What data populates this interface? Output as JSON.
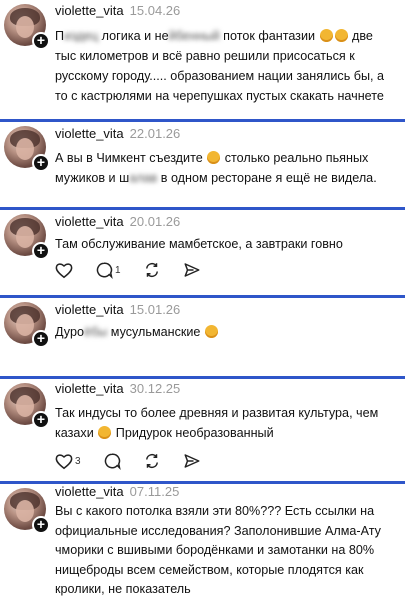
{
  "posts": [
    {
      "username": "violette_vita",
      "date": "15.04.26",
      "text_1": "П",
      "text_blur_1": "издец",
      "text_2": " логика и не",
      "text_blur_2": "йбенный",
      "text_3": " поток фантазии ",
      "text_4": " две тыс километров и всё равно решили присосаться к русскому городу..... образованием нации занялись бы, а то с кастрюлями на черепушках пустых скакать начнете"
    },
    {
      "username": "violette_vita",
      "date": "22.01.26",
      "text_1": "А вы в Чимкент съездите ",
      "text_2": " столько реально пьяных мужиков и ш",
      "text_blur_1": "алав",
      "text_3": " в одном ресторане я ещё не видела."
    },
    {
      "username": "violette_vita",
      "date": "20.01.26",
      "text": "Там обслуживание мамбетское, а завтраки говно",
      "comments": "1"
    },
    {
      "username": "violette_vita",
      "date": "15.01.26",
      "text_1": "Дуро",
      "text_blur_1": "ёбы",
      "text_2": " мусульманские "
    },
    {
      "username": "violette_vita",
      "date": "30.12.25",
      "text_1": "Так индусы то более древняя и развитая культура, чем казахи ",
      "text_2": " Придурок необразованный",
      "likes": "3"
    },
    {
      "username": "violette_vita",
      "date": "07.11.25",
      "text": "Вы с какого потолка взяли эти 80%??? Есть ссылки на официальные исследования? Заполонившие Алма-Ату чморики с вшивыми бородёнками и замотанки на 80% нищеброды всем семейством, которые плодятся как кролики, не показатель"
    }
  ],
  "colors": {
    "divider": "#2f56c9",
    "date": "#9a9a9a"
  },
  "icons": [
    "heart-icon",
    "comment-icon",
    "repost-icon",
    "share-icon",
    "plus-icon"
  ]
}
